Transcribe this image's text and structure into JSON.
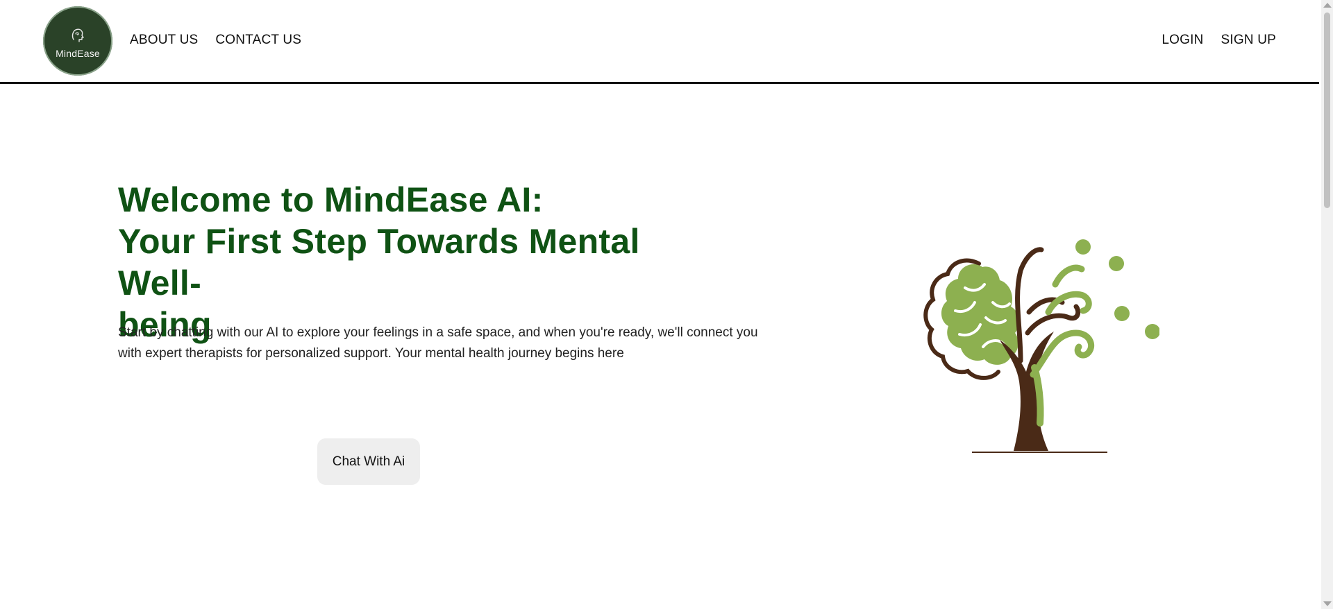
{
  "navbar": {
    "logo_text": "MindEase",
    "left_links": [
      "ABOUT US",
      "CONTACT US"
    ],
    "right_links": [
      "LOGIN",
      "SIGN UP"
    ]
  },
  "hero": {
    "title_line1": "Welcome to MindEase AI:",
    "title_line2": "Your First Step Towards Mental Well-",
    "title_line3": "being",
    "description": "Start by chatting with our AI to explore your feelings in a safe space, and when you're ready, we'll connect you with expert therapists for personalized support. Your mental health journey begins here",
    "cta_label": "Chat With Ai"
  },
  "colors": {
    "title": "#0f5214",
    "logo_bg": "#2a4228",
    "tree_leaf": "#8db050",
    "tree_trunk": "#4a2a17"
  },
  "icons": {
    "logo": "head-icon",
    "illustration": "brain-tree-icon"
  }
}
